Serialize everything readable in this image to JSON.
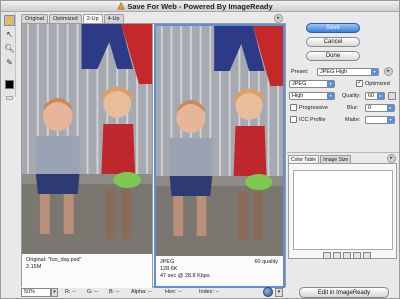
{
  "window": {
    "title": "Save For Web - Powered By ImageReady"
  },
  "tabs": [
    "Original",
    "Optimized",
    "2-Up",
    "4-Up"
  ],
  "active_tab": "2-Up",
  "panes": {
    "left": {
      "line1": "Original: \"fun_day.psd\"",
      "line2": "2.15M"
    },
    "right": {
      "line1": "JPEG",
      "line2": "128.6K",
      "line3": "47 sec @ 28.8 Kbps",
      "quality": "60 quality"
    }
  },
  "status_bar": {
    "zoom": "50%",
    "r": "R: --",
    "g": "G: --",
    "b": "B: --",
    "alpha": "Alpha: --",
    "hex": "Hex: --",
    "index": "Index: --"
  },
  "buttons": {
    "save": "Save",
    "cancel": "Cancel",
    "done": "Done",
    "edit": "Edit in ImageReady"
  },
  "settings": {
    "preset_label": "Preset:",
    "preset_value": "JPEG High",
    "format": "JPEG",
    "optimized_label": "Optimized",
    "optimized_checked": true,
    "compression": "High",
    "quality_label": "Quality:",
    "quality_value": "60",
    "progressive_label": "Progressive",
    "blur_label": "Blur:",
    "blur_value": "0",
    "icc_label": "ICC Profile",
    "matte_label": "Matte:"
  },
  "table_tabs": [
    "Color Table",
    "Image Size"
  ],
  "colors": {
    "accent": "#3b7fdc",
    "selection_border": "#5c8fd4"
  }
}
